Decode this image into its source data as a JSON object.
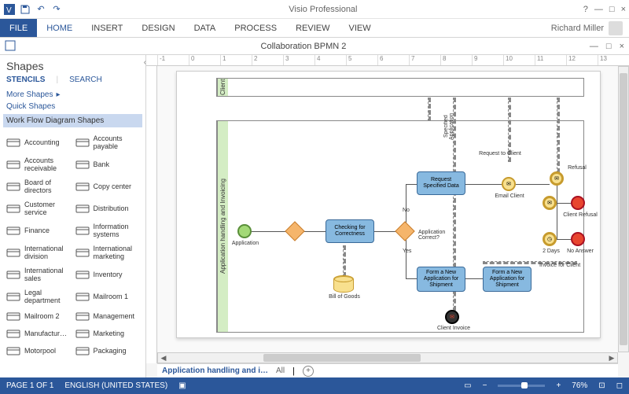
{
  "titlebar": {
    "app_title": "Visio Professional"
  },
  "window_controls": {
    "help": "?",
    "min": "—",
    "max": "□",
    "close": "×"
  },
  "ribbon": {
    "tabs": [
      "FILE",
      "HOME",
      "INSERT",
      "DESIGN",
      "DATA",
      "PROCESS",
      "REVIEW",
      "VIEW"
    ],
    "user_name": "Richard Miller"
  },
  "document": {
    "title": "Collaboration BPMN 2"
  },
  "shapes_panel": {
    "title": "Shapes",
    "tabs": {
      "stencils": "STENCILS",
      "search": "SEARCH"
    },
    "more_shapes": "More Shapes",
    "quick_shapes": "Quick Shapes",
    "active_category": "Work Flow Diagram Shapes",
    "items": [
      {
        "icon": "ledger",
        "label": "Accounting"
      },
      {
        "icon": "invoice",
        "label": "Accounts payable"
      },
      {
        "icon": "cash",
        "label": "Accounts receivable"
      },
      {
        "icon": "bank",
        "label": "Bank"
      },
      {
        "icon": "people",
        "label": "Board of directors"
      },
      {
        "icon": "copier",
        "label": "Copy center"
      },
      {
        "icon": "headset",
        "label": "Customer service"
      },
      {
        "icon": "truck",
        "label": "Distribution"
      },
      {
        "icon": "chart",
        "label": "Finance"
      },
      {
        "icon": "server",
        "label": "Information systems"
      },
      {
        "icon": "globe",
        "label": "International division"
      },
      {
        "icon": "globe-mk",
        "label": "International marketing"
      },
      {
        "icon": "globe-s",
        "label": "International sales"
      },
      {
        "icon": "boxes",
        "label": "Inventory"
      },
      {
        "icon": "gavel",
        "label": "Legal department"
      },
      {
        "icon": "mail",
        "label": "Mailroom 1"
      },
      {
        "icon": "mail2",
        "label": "Mailroom 2"
      },
      {
        "icon": "org",
        "label": "Management"
      },
      {
        "icon": "gears",
        "label": "Manufactur…"
      },
      {
        "icon": "megaphone",
        "label": "Marketing"
      },
      {
        "icon": "car",
        "label": "Motorpool"
      },
      {
        "icon": "box",
        "label": "Packaging"
      }
    ]
  },
  "ruler": {
    "marks": [
      "-1",
      "0",
      "1",
      "2",
      "3",
      "4",
      "5",
      "6",
      "7",
      "8",
      "9",
      "10",
      "11",
      "12",
      "13"
    ]
  },
  "diagram": {
    "pools": {
      "client": "Client",
      "main": "Application handling and Invoicing"
    },
    "lane_label": "Specified Application",
    "nodes": {
      "start": "Application",
      "check": "Checking for Correctness",
      "request": "Request Specified Data",
      "form1": "Form a New Application for Shipment",
      "form2": "Form a New Application for Shipment",
      "bill": "Bill of Goods",
      "email": "Email Client",
      "app_correct": "Application Correct?",
      "req_client": "Request to Client",
      "refusal": "Refusal",
      "client_refusal": "Client Refusal",
      "two_days": "2 Days",
      "no_answer": "No Answer",
      "invoice_client": "Invoice for Client",
      "client_invoice": "Client Invoice",
      "yes": "Yes",
      "no": "No"
    }
  },
  "page_tabs": {
    "active": "Application handling and i…",
    "all": "All",
    "pipe": "|"
  },
  "status": {
    "page": "PAGE 1 OF 1",
    "lang": "ENGLISH (UNITED STATES)",
    "zoom": "76%"
  }
}
